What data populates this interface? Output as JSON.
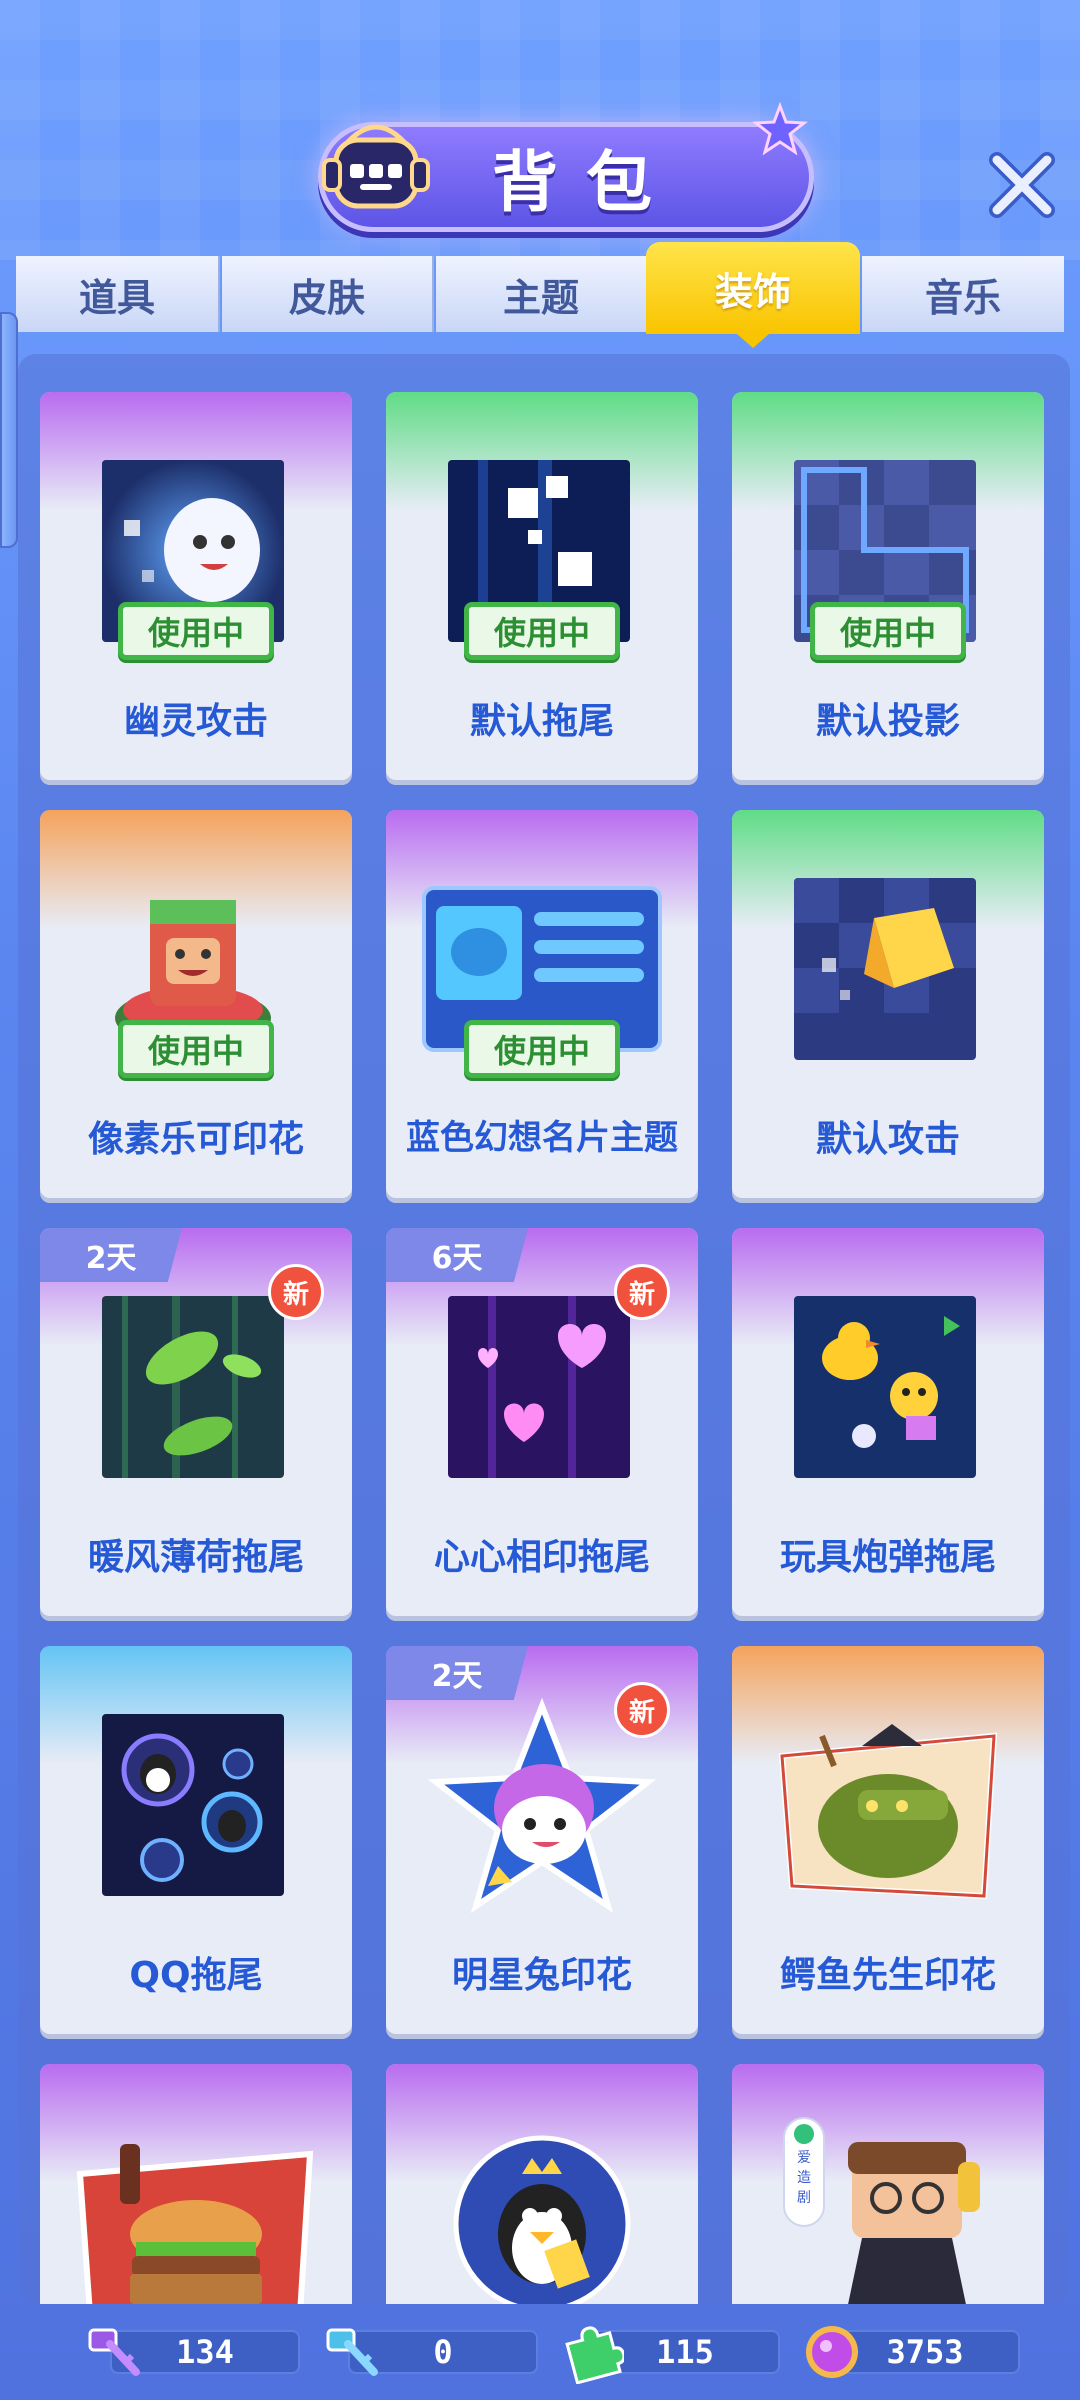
{
  "header": {
    "title": "背包"
  },
  "tabs": [
    {
      "label": "道具",
      "active": false
    },
    {
      "label": "皮肤",
      "active": false
    },
    {
      "label": "主题",
      "active": false
    },
    {
      "label": "装饰",
      "active": true
    },
    {
      "label": "音乐",
      "active": false
    }
  ],
  "items": [
    {
      "name": "幽灵攻击",
      "status": "使用中",
      "band": "purple"
    },
    {
      "name": "默认拖尾",
      "status": "使用中",
      "band": "green"
    },
    {
      "name": "默认投影",
      "status": "使用中",
      "band": "green"
    },
    {
      "name": "像素乐可印花",
      "status": "使用中",
      "band": "orange"
    },
    {
      "name": "蓝色幻想名片主题",
      "status": "使用中",
      "band": "purple"
    },
    {
      "name": "默认攻击",
      "band": "green"
    },
    {
      "name": "暖风薄荷拖尾",
      "days": "2天",
      "new": "新",
      "band": "purple"
    },
    {
      "name": "心心相印拖尾",
      "days": "6天",
      "new": "新",
      "band": "purple"
    },
    {
      "name": "玩具炮弹拖尾",
      "band": "purple"
    },
    {
      "name": "QQ拖尾",
      "band": "blue"
    },
    {
      "name": "明星兔印花",
      "days": "2天",
      "new": "新",
      "band": "purple"
    },
    {
      "name": "鳄鱼先生印花",
      "band": "orange"
    },
    {
      "name": "",
      "band": "purple"
    },
    {
      "name": "",
      "band": "purple"
    },
    {
      "name": "",
      "band": "purple",
      "thumb_text": "爱\n造\n剧"
    }
  ],
  "currency": [
    {
      "icon": "purple-key-icon",
      "value": "134"
    },
    {
      "icon": "blue-key-icon",
      "value": "0"
    },
    {
      "icon": "puzzle-piece-icon",
      "value": "115"
    },
    {
      "icon": "purple-gem-icon",
      "value": "3753"
    }
  ],
  "colors": {
    "accent_yellow": "#f9c400",
    "name_blue": "#2659d6",
    "inuse_green": "#41b548",
    "new_red": "#f0523d"
  }
}
